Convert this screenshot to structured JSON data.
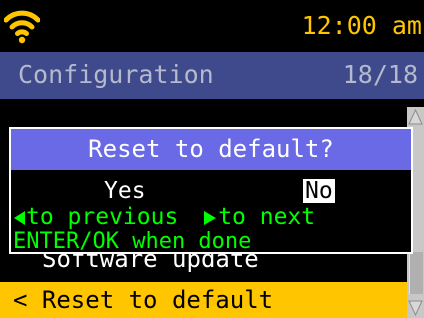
{
  "status": {
    "time": "12:00 am",
    "wifi_icon": "wifi-icon",
    "accent_color": "#FFC600"
  },
  "header": {
    "title": "Configuration",
    "page": "18/18",
    "background": "#3E4A8C"
  },
  "menu": {
    "items": [
      {
        "label": "Software update"
      },
      {
        "label": "< Reset to default",
        "selected": true
      }
    ]
  },
  "dialog": {
    "title": "Reset to default?",
    "options": [
      {
        "label": "Yes",
        "selected": false
      },
      {
        "label": "No",
        "selected": true
      }
    ],
    "hint_previous": "to previous",
    "hint_next": "to next",
    "hint_enter": "ENTER/OK when done",
    "hint_color": "#00FF00"
  },
  "scrollbar": {
    "up_icon": "scroll-up-arrow-icon",
    "down_icon": "scroll-down-arrow-icon"
  }
}
